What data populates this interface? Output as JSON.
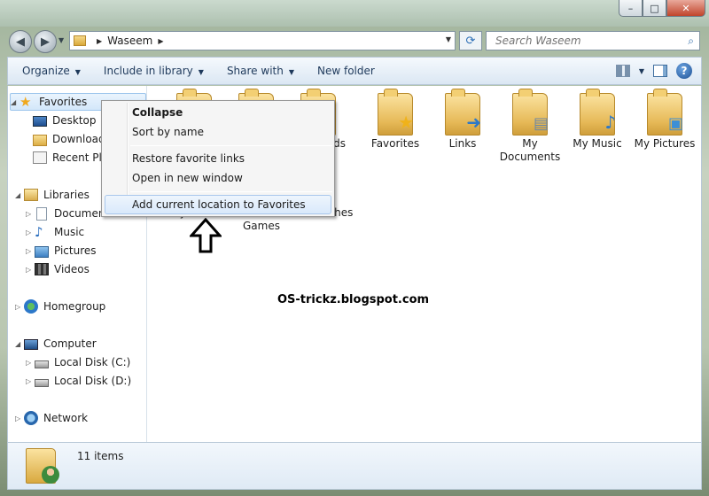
{
  "window": {
    "min_glyph": "–",
    "max_glyph": "□",
    "close_glyph": "✕"
  },
  "address": {
    "segments": [
      "Waseem"
    ],
    "search_placeholder": "Search Waseem"
  },
  "toolbar": {
    "organize": "Organize",
    "include": "Include in library",
    "share": "Share with",
    "new_folder": "New folder"
  },
  "nav": {
    "favorites": "Favorites",
    "desktop": "Desktop",
    "downloads": "Downloads",
    "recent": "Recent Places",
    "libraries": "Libraries",
    "documents": "Documents",
    "music": "Music",
    "pictures": "Pictures",
    "videos": "Videos",
    "homegroup": "Homegroup",
    "computer": "Computer",
    "disk_c": "Local Disk (C:)",
    "disk_d": "Local Disk (D:)",
    "network": "Network"
  },
  "content": {
    "items": [
      {
        "label": "Favorites",
        "overlay": "star-icon"
      },
      {
        "label": "Links",
        "overlay": "arrow-icon"
      },
      {
        "label": "My Documents",
        "overlay": "document-icon"
      },
      {
        "label": "My Music",
        "overlay": "music-icon"
      },
      {
        "label": "My Pictures",
        "overlay": "picture-icon"
      }
    ],
    "partial": {
      "downloads": "loads",
      "videos": "My Videos",
      "saved_games": "Saved Games",
      "searches": "Searches"
    }
  },
  "context_menu": {
    "collapse": "Collapse",
    "sort": "Sort by name",
    "restore": "Restore favorite links",
    "open_new": "Open in new window",
    "add_current": "Add current location to Favorites"
  },
  "watermark": "OS-trickz.blogspot.com",
  "status": {
    "item_count": "11 items"
  }
}
